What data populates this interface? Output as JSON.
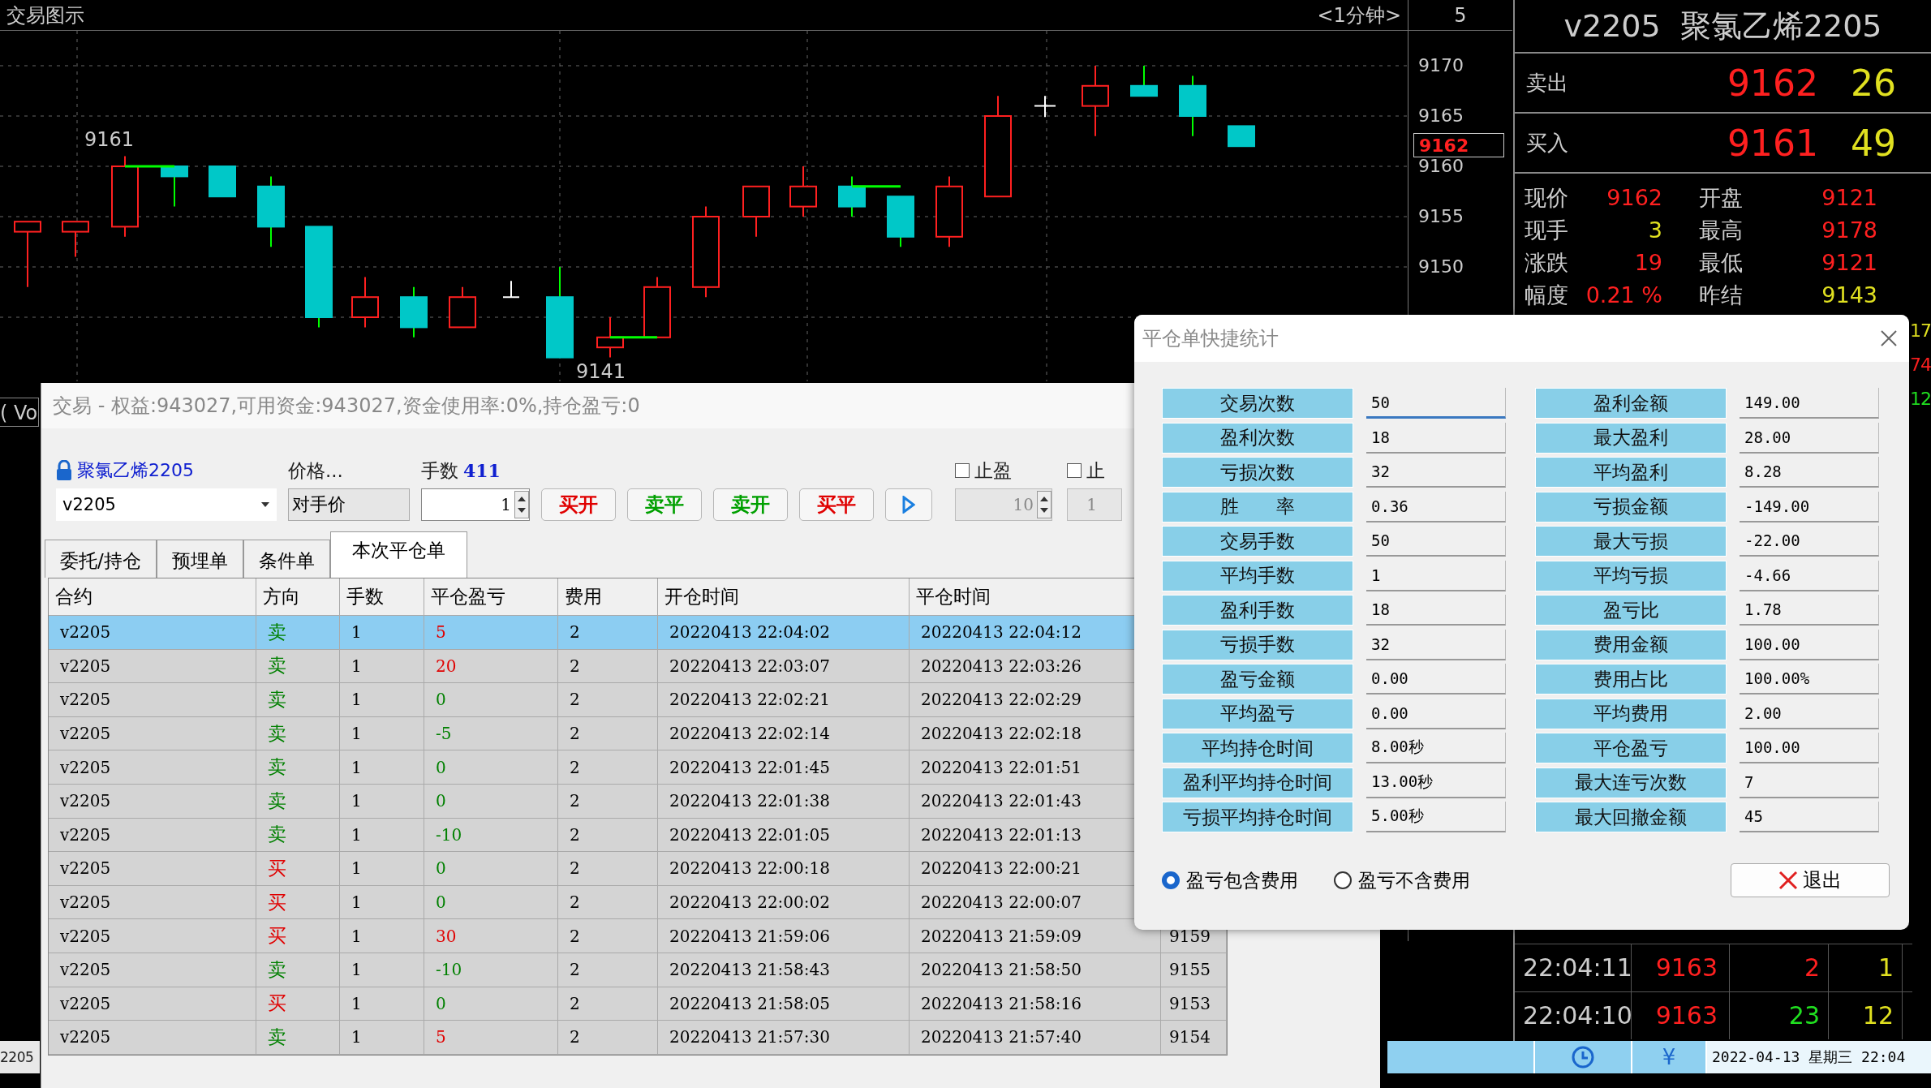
{
  "chart": {
    "title": "交易图示",
    "period": "<1分钟>",
    "axis_header": "5",
    "price_ticks": [
      "9170",
      "9165",
      "9160",
      "9155",
      "9150"
    ],
    "current_price": "9162",
    "high_label": "9161",
    "low_label": "9141"
  },
  "left_edge": {
    "top_text": "( Vo",
    "bottom_text": "2205"
  },
  "quote": {
    "title": "v2205  聚氯乙烯2205",
    "ask": {
      "label": "卖出",
      "price": "9162",
      "volume": "26"
    },
    "bid": {
      "label": "买入",
      "price": "9161",
      "volume": "49"
    },
    "stats_left": [
      {
        "label": "现价",
        "value": "9162",
        "color": "#ff2020"
      },
      {
        "label": "现手",
        "value": "3",
        "color": "#e0e020"
      },
      {
        "label": "涨跌",
        "value": "19",
        "color": "#ff2020"
      },
      {
        "label": "幅度",
        "value": "0.21 %",
        "color": "#ff2020"
      }
    ],
    "stats_right": [
      {
        "label": "开盘",
        "value": "9121",
        "color": "#ff2020"
      },
      {
        "label": "最高",
        "value": "9178",
        "color": "#ff2020"
      },
      {
        "label": "最低",
        "value": "9121",
        "color": "#ff2020"
      },
      {
        "label": "昨结",
        "value": "9143",
        "color": "#e0e020"
      }
    ],
    "edge_values": [
      {
        "value": "17",
        "color": "#e0e020"
      },
      {
        "value": "74",
        "color": "#ff2020"
      },
      {
        "value": "12",
        "color": "#20e020"
      }
    ],
    "ticks": [
      {
        "time": "22:04:11",
        "price": "9163",
        "volume": {
          "text": "2",
          "color": "#ff2020"
        },
        "count": "1"
      },
      {
        "time": "22:04:10",
        "price": "9163",
        "volume": {
          "text": "23",
          "color": "#20e020"
        },
        "count": "12"
      }
    ]
  },
  "status_bar": {
    "currency": "¥",
    "date": "2022-04-13 星期三 22:04"
  },
  "trade_window": {
    "title": "交易 - 权益:943027,可用资金:943027,资金使用率:0%,持仓盈亏:0",
    "contract_link": "聚氯乙烯2205",
    "contract_value": "v2205",
    "price_label": "价格...",
    "price_value": "对手价",
    "qty_label": "手数",
    "qty_max": "411",
    "qty_value": "1",
    "buttons": [
      {
        "label": "买开",
        "color": "#e00000"
      },
      {
        "label": "卖平",
        "color": "#00a000"
      },
      {
        "label": "卖开",
        "color": "#00a000"
      },
      {
        "label": "买平",
        "color": "#e00000"
      }
    ],
    "stops": [
      {
        "label": "止盈",
        "checked": false,
        "value": "10"
      },
      {
        "label": "止",
        "checked": false,
        "value": "1"
      }
    ],
    "tabs": [
      {
        "label": "委托/持仓",
        "selected": false
      },
      {
        "label": "预埋单",
        "selected": false
      },
      {
        "label": "条件单",
        "selected": false
      },
      {
        "label": "本次平仓单",
        "selected": true
      }
    ],
    "table": {
      "columns": [
        "合约",
        "方向",
        "手数",
        "平仓盈亏",
        "费用",
        "开仓时间",
        "平仓时间"
      ],
      "rows": [
        {
          "contract": "v2205",
          "side": {
            "text": "卖",
            "color": "#008000"
          },
          "lots": "1",
          "pnl": {
            "text": "5",
            "color": "#e00000"
          },
          "fee": "2",
          "open_time": "20220413 22:04:02",
          "close_time": "20220413 22:04:12",
          "selected": true
        },
        {
          "contract": "v2205",
          "side": {
            "text": "卖",
            "color": "#008000"
          },
          "lots": "1",
          "pnl": {
            "text": "20",
            "color": "#e00000"
          },
          "fee": "2",
          "open_time": "20220413 22:03:07",
          "close_time": "20220413 22:03:26",
          "selected": false
        },
        {
          "contract": "v2205",
          "side": {
            "text": "卖",
            "color": "#008000"
          },
          "lots": "1",
          "pnl": {
            "text": "0",
            "color": "#008000"
          },
          "fee": "2",
          "open_time": "20220413 22:02:21",
          "close_time": "20220413 22:02:29",
          "selected": false
        },
        {
          "contract": "v2205",
          "side": {
            "text": "卖",
            "color": "#008000"
          },
          "lots": "1",
          "pnl": {
            "text": "-5",
            "color": "#008000"
          },
          "fee": "2",
          "open_time": "20220413 22:02:14",
          "close_time": "20220413 22:02:18",
          "selected": false
        },
        {
          "contract": "v2205",
          "side": {
            "text": "卖",
            "color": "#008000"
          },
          "lots": "1",
          "pnl": {
            "text": "0",
            "color": "#008000"
          },
          "fee": "2",
          "open_time": "20220413 22:01:45",
          "close_time": "20220413 22:01:51",
          "selected": false
        },
        {
          "contract": "v2205",
          "side": {
            "text": "卖",
            "color": "#008000"
          },
          "lots": "1",
          "pnl": {
            "text": "0",
            "color": "#008000"
          },
          "fee": "2",
          "open_time": "20220413 22:01:38",
          "close_time": "20220413 22:01:43",
          "selected": false
        },
        {
          "contract": "v2205",
          "side": {
            "text": "卖",
            "color": "#008000"
          },
          "lots": "1",
          "pnl": {
            "text": "-10",
            "color": "#008000"
          },
          "fee": "2",
          "open_time": "20220413 22:01:05",
          "close_time": "20220413 22:01:13",
          "selected": false
        },
        {
          "contract": "v2205",
          "side": {
            "text": "买",
            "color": "#e00000"
          },
          "lots": "1",
          "pnl": {
            "text": "0",
            "color": "#008000"
          },
          "fee": "2",
          "open_time": "20220413 22:00:18",
          "close_time": "20220413 22:00:21",
          "selected": false
        },
        {
          "contract": "v2205",
          "side": {
            "text": "买",
            "color": "#e00000"
          },
          "lots": "1",
          "pnl": {
            "text": "0",
            "color": "#008000"
          },
          "fee": "2",
          "open_time": "20220413 22:00:02",
          "close_time": "20220413 22:00:07",
          "selected": false
        },
        {
          "contract": "v2205",
          "side": {
            "text": "买",
            "color": "#e00000"
          },
          "lots": "1",
          "pnl": {
            "text": "30",
            "color": "#e00000"
          },
          "fee": "2",
          "open_time": "20220413 21:59:06",
          "close_time": "20220413 21:59:09",
          "column_8": "9159",
          "selected": false
        },
        {
          "contract": "v2205",
          "side": {
            "text": "卖",
            "color": "#008000"
          },
          "lots": "1",
          "pnl": {
            "text": "-10",
            "color": "#008000"
          },
          "fee": "2",
          "open_time": "20220413 21:58:43",
          "close_time": "20220413 21:58:50",
          "column_8": "9155",
          "selected": false
        },
        {
          "contract": "v2205",
          "side": {
            "text": "买",
            "color": "#e00000"
          },
          "lots": "1",
          "pnl": {
            "text": "0",
            "color": "#008000"
          },
          "fee": "2",
          "open_time": "20220413 21:58:05",
          "close_time": "20220413 21:58:16",
          "column_8": "9153",
          "selected": false
        },
        {
          "contract": "v2205",
          "side": {
            "text": "卖",
            "color": "#008000"
          },
          "lots": "1",
          "pnl": {
            "text": "5",
            "color": "#e00000"
          },
          "fee": "2",
          "open_time": "20220413 21:57:30",
          "close_time": "20220413 21:57:40",
          "column_8": "9154",
          "selected": false
        }
      ]
    }
  },
  "stats_dialog": {
    "title": "平仓单快捷统计",
    "left": [
      {
        "label": "交易次数",
        "value": "50"
      },
      {
        "label": "盈利次数",
        "value": "18"
      },
      {
        "label": "亏损次数",
        "value": "32"
      },
      {
        "label": "胜　　率",
        "value": "0.36"
      },
      {
        "label": "交易手数",
        "value": "50"
      },
      {
        "label": "平均手数",
        "value": "1"
      },
      {
        "label": "盈利手数",
        "value": "18"
      },
      {
        "label": "亏损手数",
        "value": "32"
      },
      {
        "label": "盈亏金额",
        "value": "0.00"
      },
      {
        "label": "平均盈亏",
        "value": "0.00"
      },
      {
        "label": "平均持仓时间",
        "value": "8.00秒"
      },
      {
        "label": "盈利平均持仓时间",
        "value": "13.00秒"
      },
      {
        "label": "亏损平均持仓时间",
        "value": "5.00秒"
      }
    ],
    "right": [
      {
        "label": "盈利金额",
        "value": "149.00"
      },
      {
        "label": "最大盈利",
        "value": "28.00"
      },
      {
        "label": "平均盈利",
        "value": "8.28"
      },
      {
        "label": "亏损金额",
        "value": "-149.00"
      },
      {
        "label": "最大亏损",
        "value": "-22.00"
      },
      {
        "label": "平均亏损",
        "value": "-4.66"
      },
      {
        "label": "盈亏比",
        "value": "1.78"
      },
      {
        "label": "费用金额",
        "value": "100.00"
      },
      {
        "label": "费用占比",
        "value": "100.00%"
      },
      {
        "label": "平均费用",
        "value": "2.00"
      },
      {
        "label": "平仓盈亏",
        "value": "100.00"
      },
      {
        "label": "最大连亏次数",
        "value": "7"
      },
      {
        "label": "最大回撤金额",
        "value": "45"
      }
    ],
    "options": [
      {
        "label": "盈亏包含费用",
        "selected": true
      },
      {
        "label": "盈亏不含费用",
        "selected": false
      }
    ],
    "exit_button": "退出"
  }
}
